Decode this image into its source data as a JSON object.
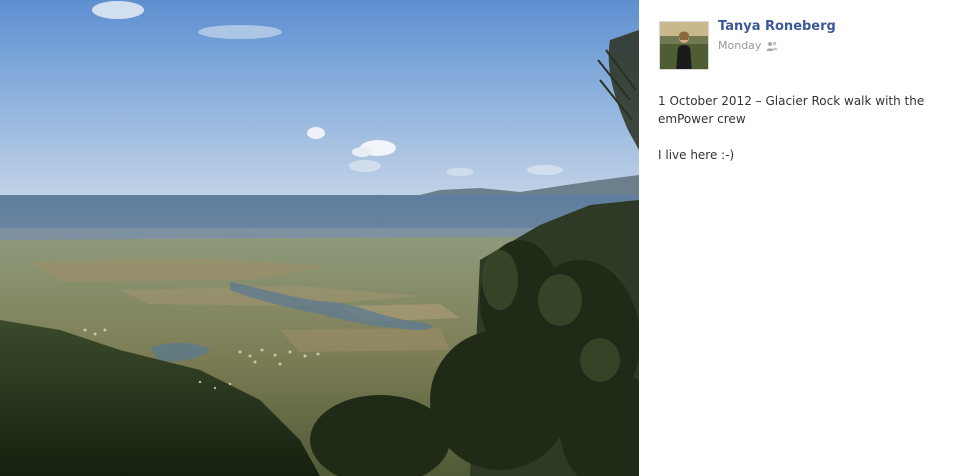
{
  "photo": {
    "subject": "photo-viewer-image"
  },
  "author": {
    "name": "Tanya Roneberg",
    "avatar_icon": "user-avatar-photo"
  },
  "meta": {
    "timestamp": "Monday",
    "audience_icon": "friends-icon"
  },
  "caption": {
    "line1": "1 October 2012 – Glacier Rock walk with the emPower crew",
    "line2": "I live here :-)"
  },
  "colors": {
    "name_link": "#3b5998",
    "meta_text": "#999999",
    "body_text": "#333333"
  }
}
